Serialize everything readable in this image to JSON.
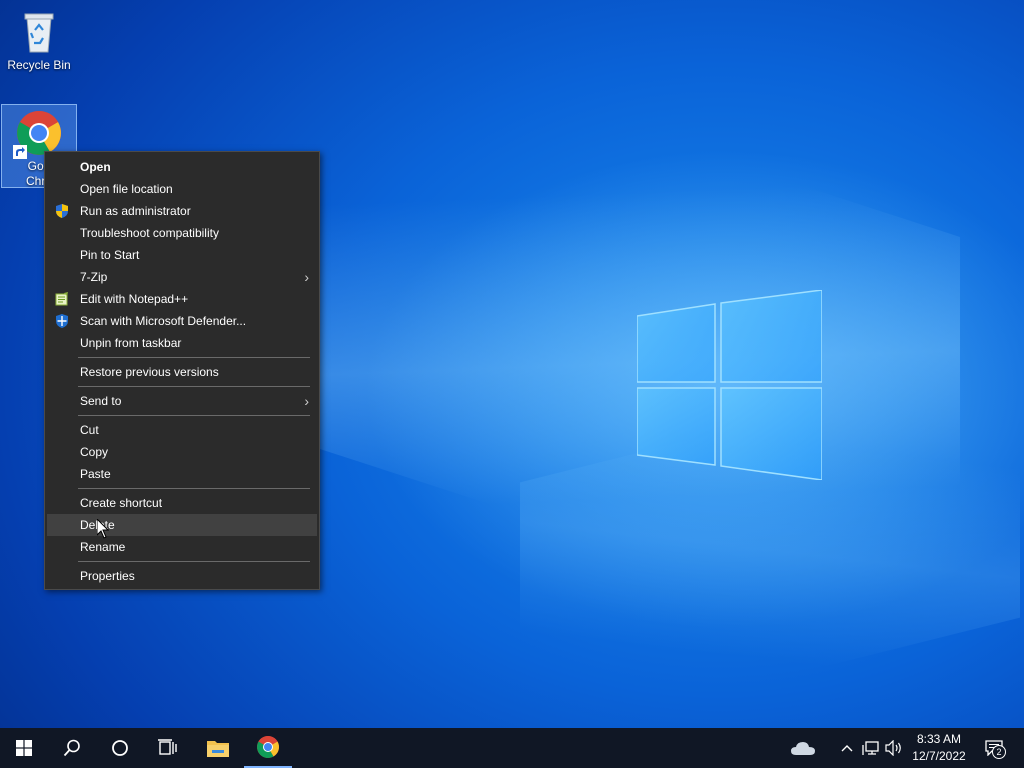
{
  "desktop": {
    "icons": [
      {
        "label": "Recycle Bin"
      },
      {
        "label_line1": "Goo",
        "label_line2": "Chro"
      }
    ]
  },
  "context_menu": {
    "groups": [
      [
        "Open",
        "Open file location",
        "Run as administrator",
        "Troubleshoot compatibility",
        "Pin to Start",
        "7-Zip",
        "Edit with Notepad++",
        "Scan with Microsoft Defender...",
        "Unpin from taskbar"
      ],
      [
        "Restore previous versions"
      ],
      [
        "Send to"
      ],
      [
        "Cut",
        "Copy",
        "Paste"
      ],
      [
        "Create shortcut",
        "Delete",
        "Rename"
      ],
      [
        "Properties"
      ]
    ],
    "highlighted_item": "Delete"
  },
  "taskbar": {
    "pinned": [
      "windows-start-icon",
      "search-icon",
      "cortana-icon",
      "task-view-icon",
      "file-explorer-icon",
      "chrome-icon"
    ],
    "tray": {
      "time": "8:33 AM",
      "date": "12/7/2022",
      "notification_count": "2"
    }
  },
  "colors": {
    "menu_bg": "#2b2b2b",
    "menu_hover": "#414141",
    "taskbar_bg": "#101725"
  }
}
